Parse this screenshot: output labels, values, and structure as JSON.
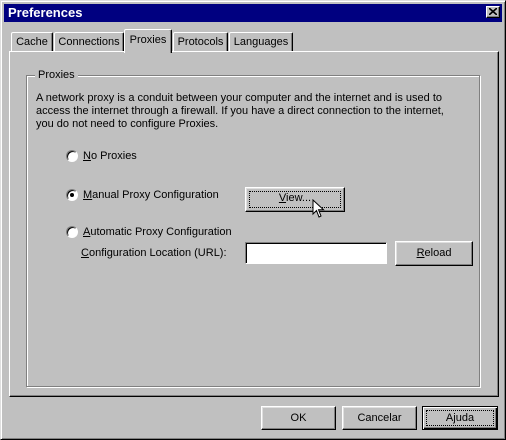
{
  "window": {
    "title": "Preferences"
  },
  "tabs": [
    {
      "label": "Cache",
      "active": false
    },
    {
      "label": "Connections",
      "active": false
    },
    {
      "label": "Proxies",
      "active": true
    },
    {
      "label": "Protocols",
      "active": false
    },
    {
      "label": "Languages",
      "active": false
    }
  ],
  "group": {
    "label": "Proxies",
    "description": [
      "A network proxy is a conduit between your computer and the internet and is used to",
      "access the internet through a firewall.  If you have a direct connection to the internet,",
      "you do not need to configure Proxies."
    ]
  },
  "options": {
    "no_proxies": {
      "mnemonic": "N",
      "rest": "o Proxies",
      "selected": false
    },
    "manual": {
      "mnemonic": "M",
      "rest": "anual Proxy Configuration",
      "selected": true
    },
    "automatic": {
      "mnemonic": "A",
      "rest": "utomatic Proxy Configuration",
      "selected": false
    }
  },
  "view_button": {
    "mnemonic": "V",
    "rest": "iew..."
  },
  "config_location": {
    "mnemonic": "C",
    "rest": "onfiguration Location (URL):",
    "value": ""
  },
  "reload_button": {
    "mnemonic": "R",
    "rest": "eload"
  },
  "footer": {
    "ok": "OK",
    "cancel": "Cancelar",
    "help": "Ajuda"
  }
}
